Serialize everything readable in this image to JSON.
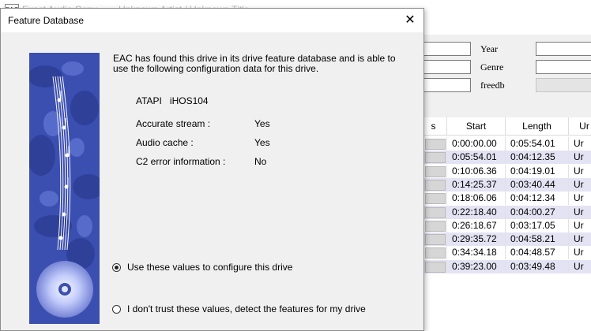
{
  "background_window": {
    "app_title": "Exact Audio Copy",
    "subtitle": "Unknown Artist / Unknown Title",
    "app_icon_label": "EAC",
    "meta_labels": {
      "year": "Year",
      "genre": "Genre",
      "freedb": "freedb"
    },
    "table": {
      "columns": [
        "s",
        "Start",
        "Length",
        "Ur"
      ],
      "rows": [
        {
          "start": "0:00:00.00",
          "length": "0:05:54.01",
          "tail": "Ur"
        },
        {
          "start": "0:05:54.01",
          "length": "0:04:12.35",
          "tail": "Ur"
        },
        {
          "start": "0:10:06.36",
          "length": "0:04:19.01",
          "tail": "Ur"
        },
        {
          "start": "0:14:25.37",
          "length": "0:03:40.44",
          "tail": "Ur"
        },
        {
          "start": "0:18:06.06",
          "length": "0:04:12.34",
          "tail": "Ur"
        },
        {
          "start": "0:22:18.40",
          "length": "0:04:00.27",
          "tail": "Ur"
        },
        {
          "start": "0:26:18.67",
          "length": "0:03:17.05",
          "tail": "Ur"
        },
        {
          "start": "0:29:35.72",
          "length": "0:04:58.21",
          "tail": "Ur"
        },
        {
          "start": "0:34:34.18",
          "length": "0:04:48.57",
          "tail": "Ur"
        },
        {
          "start": "0:39:23.00",
          "length": "0:03:49.48",
          "tail": "Ur"
        }
      ]
    }
  },
  "dialog": {
    "title": "Feature Database",
    "close_glyph": "✕",
    "intro_text": "EAC has found this drive in its drive feature database and is able to use the following configuration data for this drive.",
    "drive_name": "ATAPI   iHOS104",
    "features": [
      {
        "label": "Accurate stream :",
        "value": "Yes"
      },
      {
        "label": "Audio cache :",
        "value": "Yes"
      },
      {
        "label": "C2 error information :",
        "value": "No"
      }
    ],
    "options": [
      {
        "label": "Use these values to configure this drive",
        "selected": true
      },
      {
        "label": "I don't trust these values, detect the features for my drive",
        "selected": false
      }
    ]
  },
  "colors": {
    "banner_blue": "#3b4fb0",
    "row_alt": "#e3e3f3",
    "dialog_bg": "#f0f0f0"
  }
}
